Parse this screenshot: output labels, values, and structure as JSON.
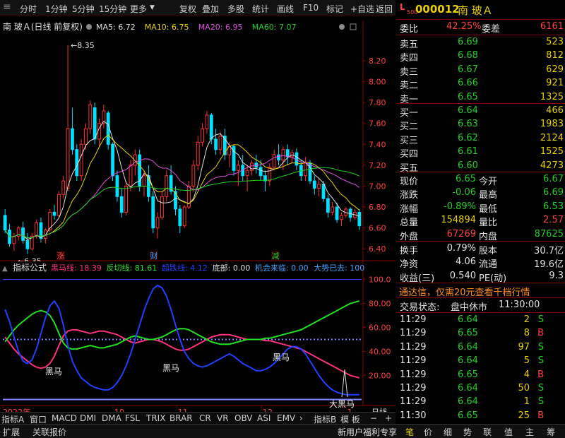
{
  "toolbar": {
    "items": [
      "分时",
      "1分钟",
      "5分钟",
      "15分钟",
      "更多",
      "复权",
      "叠加",
      "多股",
      "统计",
      "画线",
      "F10",
      "标记",
      "+自选",
      "返回"
    ]
  },
  "chart_data": [
    {
      "type": "candlestick",
      "title": "南 玻Ａ(日线 前复权)",
      "ma_legend": [
        {
          "name": "MA5",
          "value": "6.72",
          "color": "#e0e0e0"
        },
        {
          "name": "MA10",
          "value": "6.75",
          "color": "#e8d000"
        },
        {
          "name": "MA20",
          "value": "6.95",
          "color": "#e050e0"
        },
        {
          "name": "MA60",
          "value": "7.07",
          "color": "#20d020"
        }
      ],
      "ylim": [
        6.3,
        8.45
      ],
      "y_ticks": [
        "8.20",
        "8.00",
        "7.80",
        "7.60",
        "7.40",
        "7.20",
        "7.00",
        "6.80",
        "6.60",
        "6.40"
      ],
      "high_marker": "8.35",
      "low_marker": "6.35",
      "event_markers": [
        {
          "label": "涨",
          "color": "#ff4040"
        },
        {
          "label": "财",
          "color": "#40a0ff"
        },
        {
          "label": "减",
          "color": "#20d020"
        }
      ],
      "x_labels": [
        "2022年",
        "10",
        "11",
        "12",
        "1"
      ],
      "x_right_label": "日线",
      "candles": [
        [
          6.72,
          6.78,
          6.55,
          6.58
        ],
        [
          6.58,
          6.64,
          6.42,
          6.45
        ],
        [
          6.45,
          6.55,
          6.38,
          6.52
        ],
        [
          6.52,
          6.62,
          6.48,
          6.6
        ],
        [
          6.6,
          6.66,
          6.45,
          6.48
        ],
        [
          6.48,
          6.55,
          6.35,
          6.4
        ],
        [
          6.4,
          6.55,
          6.38,
          6.52
        ],
        [
          6.52,
          6.68,
          6.5,
          6.65
        ],
        [
          6.65,
          6.7,
          6.46,
          6.5
        ],
        [
          6.5,
          6.6,
          6.45,
          6.58
        ],
        [
          6.58,
          6.78,
          6.56,
          6.75
        ],
        [
          6.75,
          6.82,
          6.68,
          6.72
        ],
        [
          6.72,
          6.95,
          6.7,
          6.92
        ],
        [
          6.92,
          7.1,
          6.88,
          7.05
        ],
        [
          6.98,
          8.35,
          6.95,
          7.55
        ],
        [
          7.55,
          7.75,
          7.3,
          7.35
        ],
        [
          7.35,
          7.4,
          7.05,
          7.1
        ],
        [
          7.1,
          7.45,
          7.05,
          7.4
        ],
        [
          7.4,
          7.6,
          7.35,
          7.55
        ],
        [
          7.55,
          7.82,
          7.5,
          7.78
        ],
        [
          7.75,
          7.8,
          7.4,
          7.45
        ],
        [
          7.45,
          7.65,
          7.38,
          7.6
        ],
        [
          7.6,
          7.78,
          7.55,
          7.72
        ],
        [
          7.7,
          7.72,
          7.35,
          7.4
        ],
        [
          7.4,
          7.42,
          7.05,
          7.1
        ],
        [
          7.1,
          7.15,
          6.85,
          6.9
        ],
        [
          6.9,
          6.98,
          6.7,
          6.75
        ],
        [
          6.75,
          7.05,
          6.72,
          7.0
        ],
        [
          7.0,
          7.25,
          6.95,
          7.2
        ],
        [
          7.2,
          7.35,
          7.1,
          7.3
        ],
        [
          7.3,
          7.35,
          6.95,
          7.0
        ],
        [
          7.0,
          7.15,
          6.9,
          7.1
        ],
        [
          7.1,
          7.2,
          6.85,
          6.9
        ],
        [
          6.9,
          6.95,
          6.55,
          6.6
        ],
        [
          6.6,
          6.75,
          6.5,
          6.7
        ],
        [
          6.7,
          6.95,
          6.68,
          6.9
        ],
        [
          6.9,
          7.15,
          6.85,
          7.1
        ],
        [
          7.1,
          7.2,
          6.92,
          6.95
        ],
        [
          6.95,
          7.0,
          6.72,
          6.78
        ],
        [
          6.78,
          6.82,
          6.55,
          6.62
        ],
        [
          6.62,
          6.82,
          6.6,
          6.8
        ],
        [
          6.8,
          7.05,
          6.78,
          7.0
        ],
        [
          7.0,
          7.25,
          6.95,
          7.2
        ],
        [
          7.2,
          7.48,
          7.15,
          7.42
        ],
        [
          7.42,
          7.6,
          7.38,
          7.55
        ],
        [
          7.55,
          7.72,
          7.5,
          7.68
        ],
        [
          7.68,
          7.7,
          7.4,
          7.45
        ],
        [
          7.45,
          7.55,
          7.3,
          7.35
        ],
        [
          7.35,
          7.52,
          7.3,
          7.48
        ],
        [
          7.48,
          7.55,
          7.25,
          7.3
        ],
        [
          7.3,
          7.42,
          7.18,
          7.38
        ],
        [
          7.38,
          7.4,
          7.1,
          7.15
        ],
        [
          7.15,
          7.25,
          7.0,
          7.2
        ],
        [
          7.2,
          7.3,
          7.05,
          7.1
        ],
        [
          7.1,
          7.2,
          6.95,
          7.15
        ],
        [
          7.15,
          7.25,
          7.1,
          7.22
        ],
        [
          7.22,
          7.3,
          7.12,
          7.18
        ],
        [
          7.18,
          7.25,
          7.05,
          7.1
        ],
        [
          7.1,
          7.15,
          6.95,
          7.05
        ],
        [
          7.05,
          7.22,
          7.0,
          7.18
        ],
        [
          7.18,
          7.35,
          7.15,
          7.3
        ],
        [
          7.3,
          7.4,
          7.2,
          7.25
        ],
        [
          7.25,
          7.38,
          7.15,
          7.35
        ],
        [
          7.35,
          7.4,
          7.2,
          7.28
        ],
        [
          7.28,
          7.35,
          7.22,
          7.32
        ],
        [
          7.32,
          7.36,
          7.15,
          7.2
        ],
        [
          7.2,
          7.25,
          7.05,
          7.1
        ],
        [
          7.1,
          7.28,
          7.05,
          7.22
        ],
        [
          7.22,
          7.25,
          7.02,
          7.05
        ],
        [
          7.05,
          7.1,
          6.92,
          6.98
        ],
        [
          6.98,
          7.08,
          6.9,
          7.02
        ],
        [
          7.02,
          7.05,
          6.85,
          6.88
        ],
        [
          6.88,
          6.92,
          6.7,
          6.75
        ],
        [
          6.75,
          6.85,
          6.72,
          6.8
        ],
        [
          6.8,
          6.84,
          6.65,
          6.68
        ],
        [
          6.68,
          6.75,
          6.62,
          6.72
        ],
        [
          6.72,
          6.8,
          6.7,
          6.78
        ],
        [
          6.78,
          6.8,
          6.66,
          6.7
        ],
        [
          6.7,
          6.78,
          6.68,
          6.75
        ],
        [
          6.75,
          6.78,
          6.58,
          6.62
        ]
      ]
    },
    {
      "type": "line",
      "title": "指标公式",
      "legend": [
        {
          "name": "黑马线",
          "value": "18.39",
          "color": "#ff3080"
        },
        {
          "name": "反切线",
          "value": "81.61",
          "color": "#20e020"
        },
        {
          "name": "超跌线",
          "value": "4.12",
          "color": "#2040ff"
        },
        {
          "name": "底部",
          "value": "0.00",
          "color": "#e0e0e0"
        },
        {
          "name": "机会来临",
          "value": "0.00",
          "color": "#40a0ff"
        },
        {
          "name": "大势已去",
          "value": "100",
          "color": "#40a0ff"
        }
      ],
      "ylim": [
        -5,
        105
      ],
      "y_ticks": [
        "100.0",
        "80.00",
        "60.00",
        "40.00",
        "20.00"
      ],
      "annotations": [
        "黑马",
        "黑马",
        "黑马",
        "大黑马"
      ],
      "series": [
        {
          "name": "黑马线",
          "values": [
            52,
            47,
            42,
            38,
            35,
            32,
            29,
            27,
            26,
            27,
            30,
            36,
            45,
            53,
            57,
            58,
            58,
            57,
            56,
            55,
            56,
            57,
            57,
            56,
            55,
            54,
            52,
            50,
            48,
            47,
            48,
            49,
            50,
            50,
            49,
            48,
            46,
            44,
            42,
            41,
            41,
            42,
            44,
            46,
            48,
            50,
            52,
            53,
            54,
            54,
            54,
            53,
            52,
            51,
            50,
            50,
            50,
            50,
            49,
            49,
            48,
            47,
            46,
            45,
            44,
            43,
            42,
            40,
            38,
            36,
            34,
            32,
            30,
            28,
            26,
            24,
            22,
            20,
            19,
            18
          ]
        },
        {
          "name": "反切线",
          "values": [
            48,
            53,
            58,
            62,
            65,
            68,
            71,
            73,
            74,
            73,
            70,
            64,
            55,
            47,
            43,
            42,
            42,
            43,
            44,
            45,
            44,
            43,
            43,
            44,
            45,
            46,
            48,
            50,
            52,
            53,
            52,
            51,
            50,
            50,
            51,
            52,
            54,
            56,
            58,
            59,
            59,
            58,
            56,
            54,
            52,
            50,
            48,
            47,
            46,
            46,
            46,
            47,
            48,
            49,
            50,
            50,
            50,
            50,
            51,
            51,
            52,
            53,
            54,
            55,
            56,
            57,
            58,
            60,
            62,
            64,
            66,
            68,
            70,
            72,
            74,
            76,
            78,
            80,
            81,
            82
          ]
        },
        {
          "name": "超跌线",
          "values": [
            75,
            65,
            52,
            40,
            32,
            30,
            33,
            42,
            55,
            68,
            78,
            82,
            76,
            62,
            45,
            32,
            24,
            18,
            15,
            12,
            10,
            9,
            8,
            8,
            10,
            14,
            20,
            28,
            38,
            50,
            62,
            74,
            84,
            92,
            95,
            93,
            86,
            75,
            62,
            50,
            40,
            34,
            30,
            28,
            27,
            28,
            30,
            32,
            34,
            36,
            38,
            36,
            33,
            30,
            28,
            26,
            24,
            24,
            25,
            27,
            30,
            34,
            38,
            42,
            44,
            44,
            42,
            38,
            32,
            26,
            20,
            15,
            11,
            8,
            6,
            5,
            4,
            4,
            4,
            4
          ]
        }
      ],
      "end_spike": {
        "value": 25
      }
    }
  ],
  "side": {
    "ticker_badge_top": "L",
    "ticker_badge_bottom": "500",
    "code": "000012",
    "name": "南 玻Ａ",
    "weibi_label": "委比",
    "weibi_value": "42.25%",
    "weicha_label": "委差",
    "weicha_value": "6161",
    "asks": [
      {
        "label": "卖五",
        "price": "6.69",
        "vol": "523"
      },
      {
        "label": "卖四",
        "price": "6.68",
        "vol": "812"
      },
      {
        "label": "卖三",
        "price": "6.67",
        "vol": "629"
      },
      {
        "label": "卖二",
        "price": "6.66",
        "vol": "921"
      },
      {
        "label": "卖一",
        "price": "6.65",
        "vol": "1325"
      }
    ],
    "bids": [
      {
        "label": "买一",
        "price": "6.64",
        "vol": "466"
      },
      {
        "label": "买二",
        "price": "6.63",
        "vol": "1983"
      },
      {
        "label": "买三",
        "price": "6.62",
        "vol": "2124"
      },
      {
        "label": "买四",
        "price": "6.61",
        "vol": "1525"
      },
      {
        "label": "买五",
        "price": "6.60",
        "vol": "4273"
      }
    ],
    "quote": [
      {
        "l1": "现价",
        "v1": "6.65",
        "c1": "green",
        "l2": "今开",
        "v2": "6.67",
        "c2": "green"
      },
      {
        "l1": "涨跌",
        "v1": "-0.06",
        "c1": "green",
        "l2": "最高",
        "v2": "6.69",
        "c2": "green"
      },
      {
        "l1": "涨幅",
        "v1": "-0.89%",
        "c1": "green",
        "l2": "最低",
        "v2": "6.53",
        "c2": "green"
      },
      {
        "l1": "总量",
        "v1": "154894",
        "c1": "yellow",
        "l2": "量比",
        "v2": "2.57",
        "c2": "red"
      },
      {
        "l1": "外盘",
        "v1": "67269",
        "c1": "red",
        "l2": "内盘",
        "v2": "87625",
        "c2": "green"
      }
    ],
    "stats": [
      {
        "l1": "换手",
        "v1": "0.79%",
        "l2": "股本",
        "v2": "30.7亿"
      },
      {
        "l1": "净资",
        "v1": "4.06",
        "l2": "流通",
        "v2": "19.6亿"
      },
      {
        "l1": "收益(三)",
        "v1": "0.540",
        "l2": "PE(动)",
        "v2": "9.3"
      }
    ],
    "promo": "通达信，仅需20元查看千档行情",
    "status_label": "交易状态:",
    "status_value": "盘中休市",
    "status_time": "11:30:00",
    "ticks": [
      {
        "time": "11:29",
        "price": "6.64",
        "vol": "2",
        "side": "S"
      },
      {
        "time": "11:29",
        "price": "6.65",
        "vol": "8",
        "side": "B"
      },
      {
        "time": "11:29",
        "price": "6.64",
        "vol": "97",
        "side": "S"
      },
      {
        "time": "11:29",
        "price": "6.64",
        "vol": "5",
        "side": "S"
      },
      {
        "time": "11:29",
        "price": "6.65",
        "vol": "4",
        "side": "B"
      },
      {
        "time": "11:29",
        "price": "6.64",
        "vol": "50",
        "side": "S"
      },
      {
        "time": "11:29",
        "price": "6.64",
        "vol": "1",
        "side": "S"
      },
      {
        "time": "11:30",
        "price": "6.65",
        "vol": "25",
        "side": "B"
      }
    ]
  },
  "indicator_tabs": [
    "指标A",
    "窗口",
    "MACD",
    "DMI",
    "DMA",
    "FSL",
    "TRIX",
    "BRAR",
    "CR",
    "VR",
    "OBV",
    "ASI",
    "EMV",
    "指标B",
    "模 板"
  ],
  "bottom": {
    "left_items": [
      "扩展",
      "关联报价"
    ],
    "right_promo": "新用户福利专享",
    "right_tabs": [
      "笔",
      "价",
      "细",
      "势",
      "联",
      "值",
      "主",
      "筹"
    ]
  },
  "colors": {
    "up": "#ff3030",
    "down": "#00e0ff",
    "grid": "#8a0000",
    "bg": "#000000"
  }
}
